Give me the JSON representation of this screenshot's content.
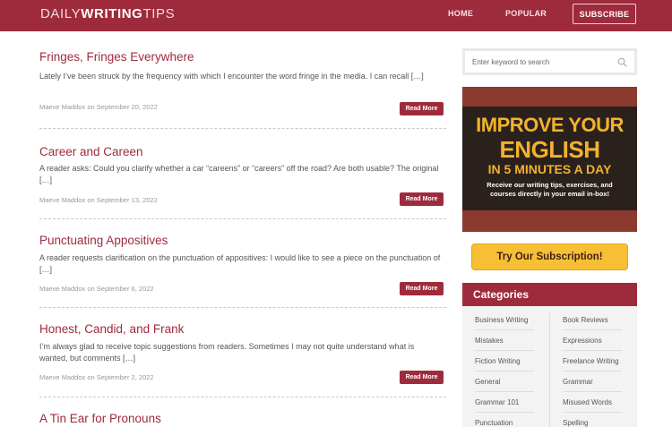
{
  "header": {
    "logo_light_1": "DAILY",
    "logo_bold": "WRITING",
    "logo_light_2": "TIPS",
    "nav": {
      "home": "HOME",
      "popular": "POPULAR",
      "subscribe": "SUBSCRIBE"
    }
  },
  "posts": [
    {
      "title": "Fringes, Fringes Everywhere",
      "excerpt": "Lately I’ve been struck by the frequency with which I encounter the word fringe in the media. I can recall […]",
      "meta": "Maeve Maddox on September 20, 2022",
      "read_more": "Read More"
    },
    {
      "title": "Career and Careen",
      "excerpt": "A reader asks: Could you clarify whether a car “careens” or “careers” off the road? Are both usable? The original […]",
      "meta": "Maeve Maddox on September 13, 2022",
      "read_more": "Read More"
    },
    {
      "title": "Punctuating Appositives",
      "excerpt": "A reader requests clarification on the punctuation of appositives: I would like to see a piece on the punctuation of […]",
      "meta": "Maeve Maddox on September 6, 2022",
      "read_more": "Read More"
    },
    {
      "title": "Honest, Candid, and Frank",
      "excerpt": "I’m always glad to receive topic suggestions from readers. Sometimes I may not quite understand what is wanted, but comments […]",
      "meta": "Maeve Maddox on September 2, 2022",
      "read_more": "Read More"
    },
    {
      "title": "A Tin Ear for Pronouns"
    }
  ],
  "sidebar": {
    "search_placeholder": "Enter keyword to search",
    "ad": {
      "line1": "IMPROVE YOUR",
      "line2": "ENGLISH",
      "line3": "IN 5 MINUTES A DAY",
      "copy": "Receive our writing tips, exercises, and courses directly in your email in-box!"
    },
    "cta": "Try Our Subscription!",
    "categories_title": "Categories",
    "categories_left": [
      "Business Writing",
      "Mistakes",
      "Fiction Writing",
      "General",
      "Grammar 101",
      "Punctuation"
    ],
    "categories_right": [
      "Book Reviews",
      "Expressions",
      "Freelance Writing",
      "Grammar",
      "Misused Words",
      "Spelling"
    ]
  },
  "colors": {
    "brand": "#9e2b3c",
    "cta": "#f7bf34",
    "ad_text": "#f3b22d"
  }
}
